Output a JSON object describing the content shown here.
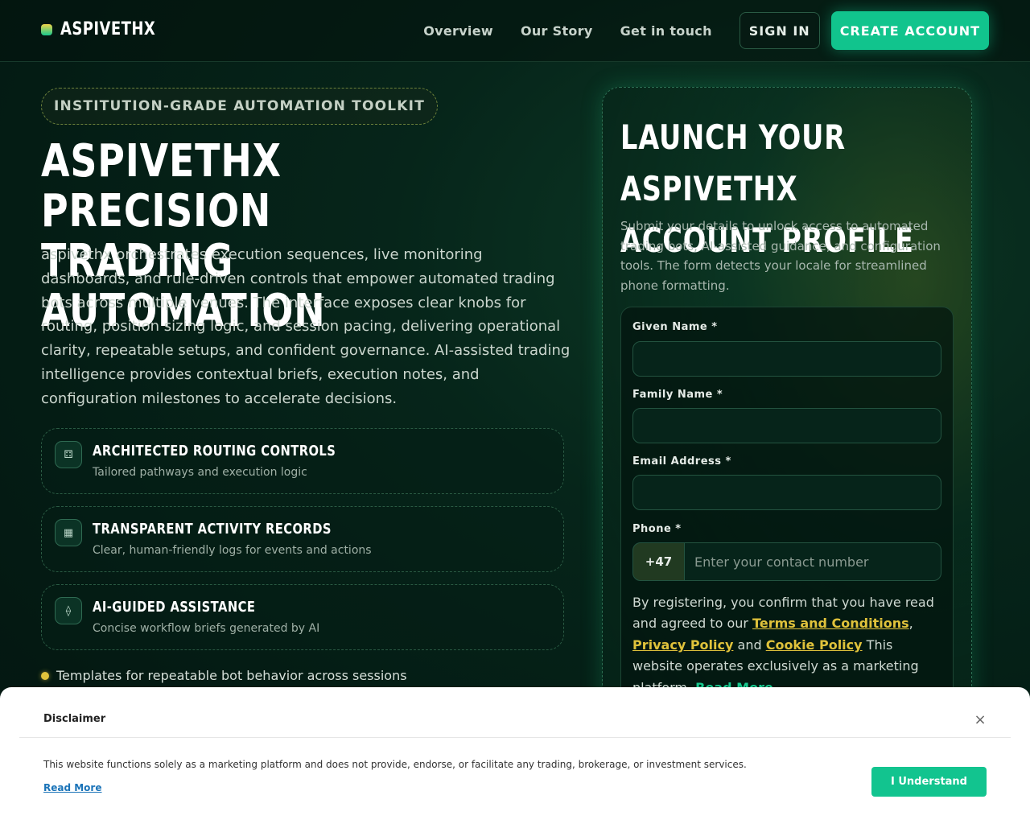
{
  "header": {
    "brand": "ASPIVETHX",
    "nav": [
      {
        "label": "Overview"
      },
      {
        "label": "Our Story"
      },
      {
        "label": "Get in touch"
      }
    ],
    "signin_label": "SIGN IN",
    "create_label": "CREATE ACCOUNT"
  },
  "hero": {
    "badge": "INSTITUTION-GRADE AUTOMATION TOOLKIT",
    "title_line1": "ASPIVETHX PRECISION",
    "title_line2": "TRADING AUTOMATION",
    "description": "aspivethx orchestrates execution sequences, live monitoring dashboards, and rule-driven controls that empower automated trading bots across multiple venues. The interface exposes clear knobs for routing, position sizing logic, and session pacing, delivering operational clarity, repeatable setups, and confident governance. AI-assisted trading intelligence provides contextual briefs, execution notes, and configuration milestones to accelerate decisions."
  },
  "features": [
    {
      "icon": "routing-icon",
      "glyph": "⚃",
      "title": "ARCHITECTED ROUTING CONTROLS",
      "subtitle": "Tailored pathways and execution logic"
    },
    {
      "icon": "records-icon",
      "glyph": "▦",
      "title": "TRANSPARENT ACTIVITY RECORDS",
      "subtitle": "Clear, human-friendly logs for events and actions"
    },
    {
      "icon": "ai-icon",
      "glyph": "⟠",
      "title": "AI-GUIDED ASSISTANCE",
      "subtitle": "Concise workflow briefs generated by AI"
    }
  ],
  "bullet": "Templates for repeatable bot behavior across sessions",
  "form": {
    "title_line1": "LAUNCH YOUR ASPIVETHX",
    "title_line2": "ACCOUNT PROFILE",
    "description": "Submit your details to unlock access to automated trading bots, AI-assisted guidance, and configuration tools. The form detects your locale for streamlined phone formatting.",
    "given_name_label": "Given Name *",
    "family_name_label": "Family Name *",
    "email_label": "Email Address *",
    "phone_label": "Phone *",
    "phone_prefix": "+47",
    "phone_placeholder": "Enter your contact number",
    "consent_prefix": "By registering, you confirm that you have read and agreed to our ",
    "terms_link": "Terms and Conditions",
    "comma": ",",
    "privacy_link": "Privacy Policy",
    "and_text": " and ",
    "cookie_link": "Cookie Policy",
    "consent_suffix": " This website operates exclusively as a marketing platform. ",
    "read_more": "Read More"
  },
  "disclaimer": {
    "title": "Disclaimer",
    "close": "×",
    "text": "This website functions solely as a marketing platform and does not provide, endorse, or facilitate any trading, brokerage, or investment services.",
    "read_more": "Read More",
    "button": "I Understand"
  },
  "colors": {
    "accent": "#11c48d",
    "gold": "#e0c23b",
    "background": "#041c14"
  }
}
